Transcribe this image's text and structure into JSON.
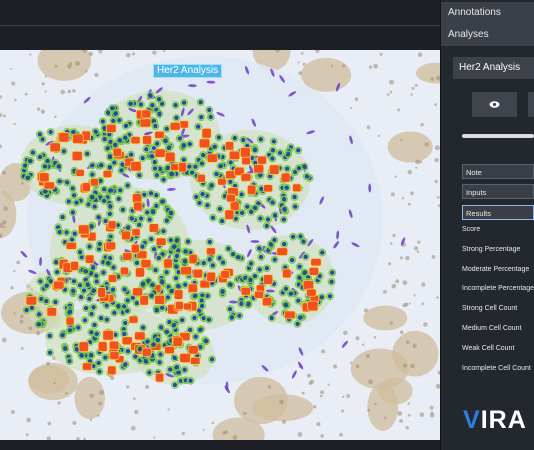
{
  "viewer": {
    "roi_label": "Her2 Analysis"
  },
  "panel": {
    "sections": {
      "annotations": "Annotations",
      "analyses": "Analyses"
    },
    "analysis_select": "Her2 Analysis",
    "rows": {
      "note": "Note",
      "inputs": "Inputs",
      "results": "Results"
    },
    "result_labels": [
      "Score",
      "Strong Percentage",
      "Moderate Percentage",
      "Incomplete Percentage",
      "Strong Cell Count",
      "Medium Cell Count",
      "Weak Cell Count",
      "Incomplete Cell Count"
    ],
    "logo": {
      "v": "V",
      "rest": "IRA"
    }
  },
  "icons": {
    "eye": "eye-icon"
  },
  "colors": {
    "roi_label_bg": "#4fb7e6",
    "strong_cell": "#f0511e",
    "moderate_cell": "#7ac943",
    "negative_cell": "#1f4e9a",
    "stroma": "#6a3cc8",
    "logo_accent": "#2b7fe0"
  }
}
